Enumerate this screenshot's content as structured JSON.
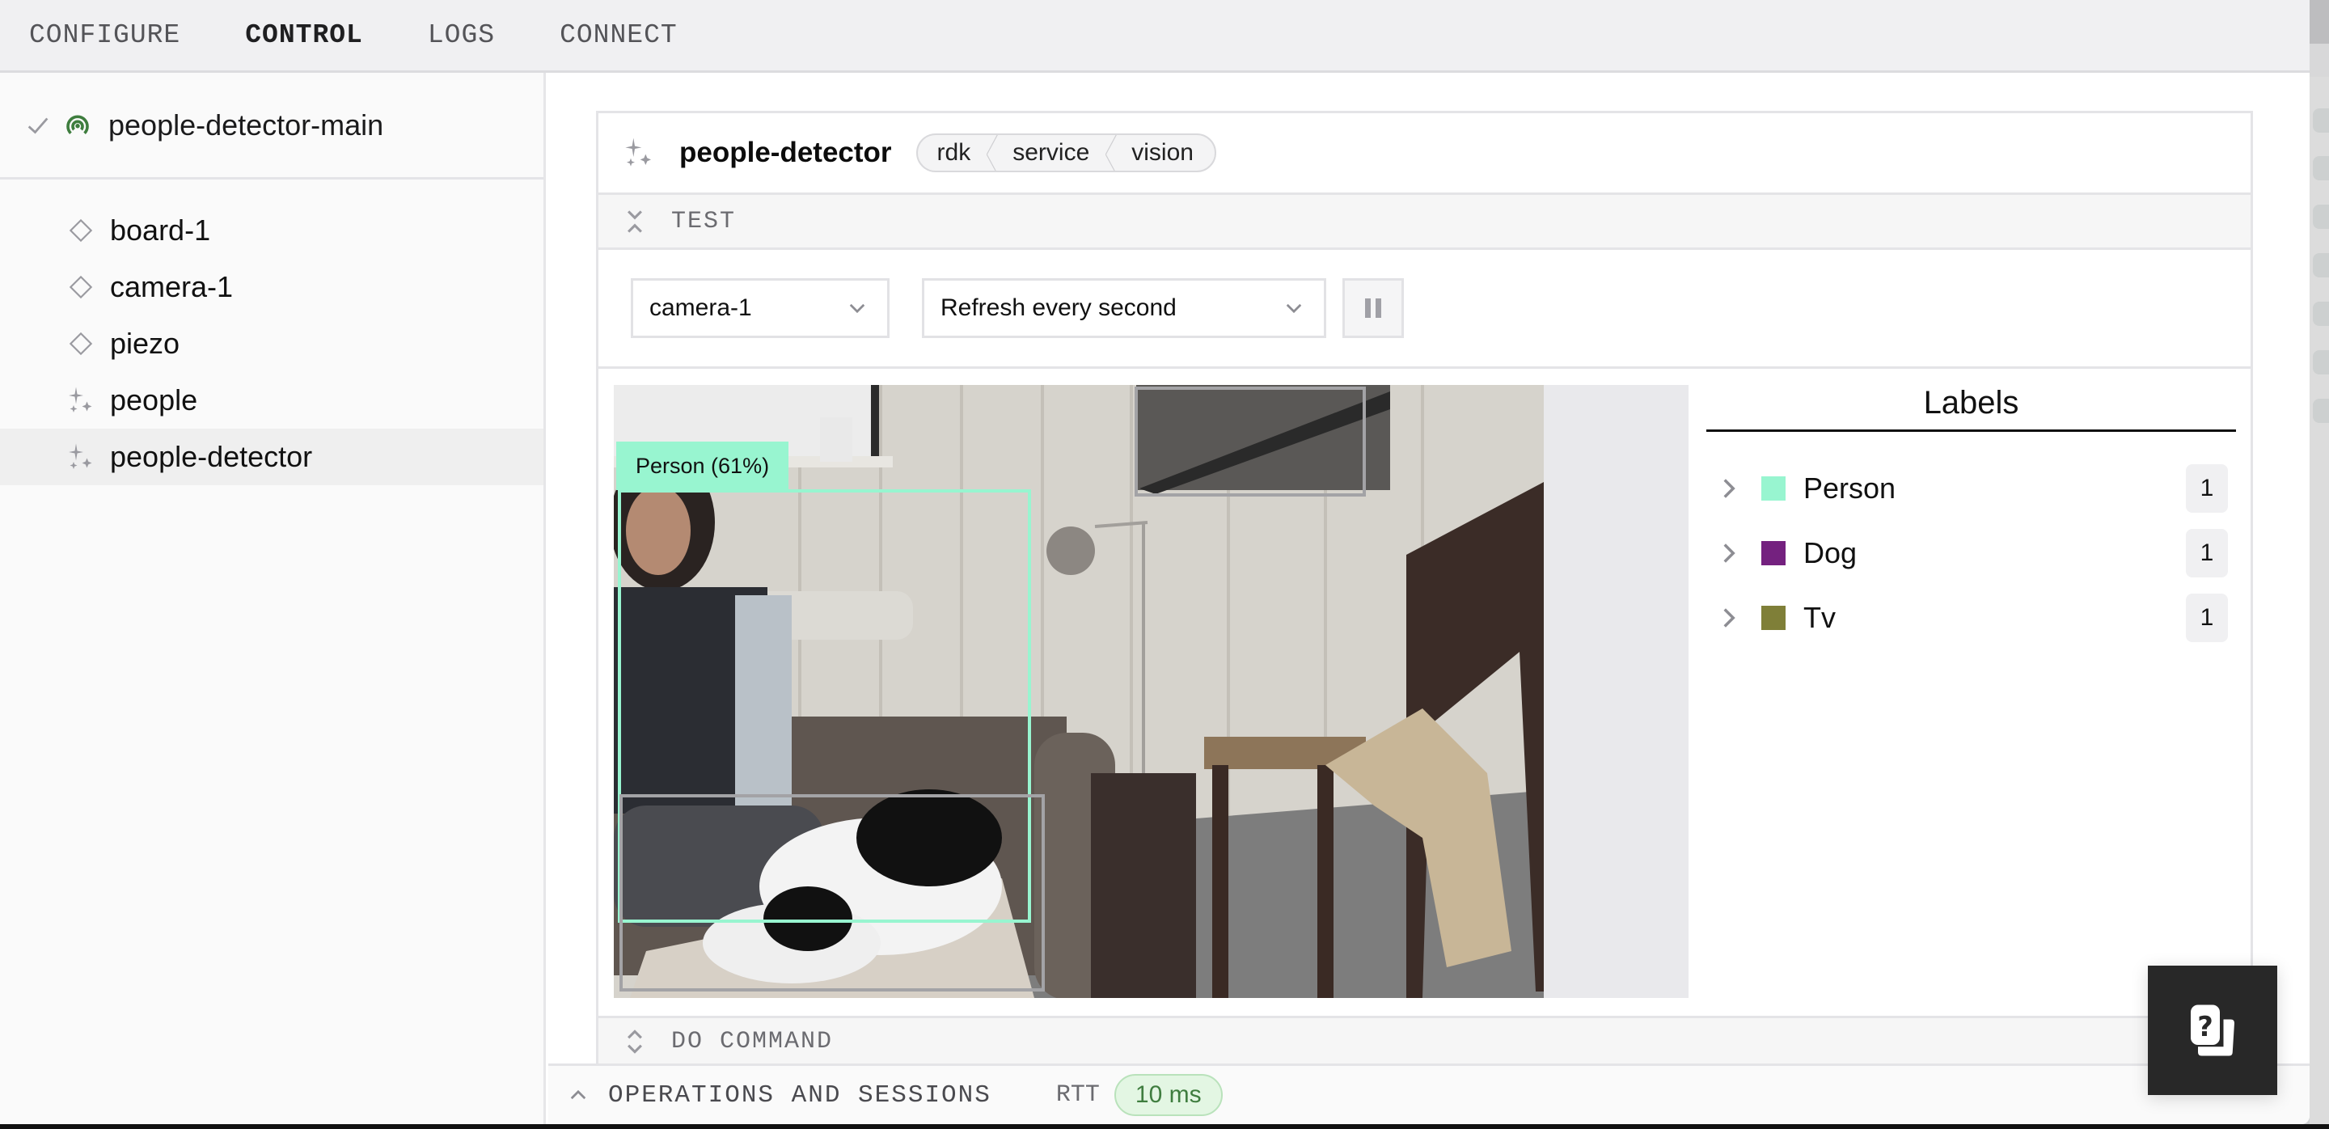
{
  "topnav": {
    "tabs": [
      {
        "label": "CONFIGURE",
        "active": false
      },
      {
        "label": "CONTROL",
        "active": true
      },
      {
        "label": "LOGS",
        "active": false
      },
      {
        "label": "CONNECT",
        "active": false
      }
    ]
  },
  "sidebar": {
    "robot": {
      "name": "people-detector-main",
      "status_icon": "check-icon",
      "type_icon": "signal-icon",
      "status_color": "#3e7d3e"
    },
    "items": [
      {
        "label": "board-1",
        "icon": "diamond-icon",
        "selected": false
      },
      {
        "label": "camera-1",
        "icon": "diamond-icon",
        "selected": false
      },
      {
        "label": "piezo",
        "icon": "diamond-icon",
        "selected": false
      },
      {
        "label": "people",
        "icon": "sparkle-icon",
        "selected": false
      },
      {
        "label": "people-detector",
        "icon": "sparkle-icon",
        "selected": true
      }
    ]
  },
  "card": {
    "title": "people-detector",
    "icon": "sparkle-icon",
    "breadcrumb": [
      "rdk",
      "service",
      "vision"
    ],
    "test_section": {
      "title": "TEST",
      "expanded": true
    },
    "controls": {
      "camera_select": {
        "value": "camera-1"
      },
      "refresh_select": {
        "value": "Refresh every second"
      },
      "pause_button": {
        "icon": "pause-icon"
      }
    },
    "detections": [
      {
        "label": "Person (61%)",
        "class": "Person",
        "confidence": 0.61,
        "color": "#98f5d0",
        "labeled": true
      },
      {
        "class": "Dog",
        "color": "#a3a3a6",
        "labeled": false
      },
      {
        "class": "Tv",
        "color": "#a3a3a6",
        "labeled": false
      }
    ],
    "labels_panel": {
      "title": "Labels",
      "items": [
        {
          "name": "Person",
          "color": "#98f5d0",
          "count": "1"
        },
        {
          "name": "Dog",
          "color": "#74217f",
          "count": "1"
        },
        {
          "name": "Tv",
          "color": "#7f7f38",
          "count": "1"
        }
      ]
    },
    "do_command_section": {
      "title": "DO COMMAND",
      "expanded": false
    }
  },
  "ops_bar": {
    "title": "OPERATIONS AND SESSIONS",
    "rtt_label": "RTT",
    "rtt_value": "10 ms"
  },
  "help_button": {
    "icon": "help-chat-icon"
  }
}
